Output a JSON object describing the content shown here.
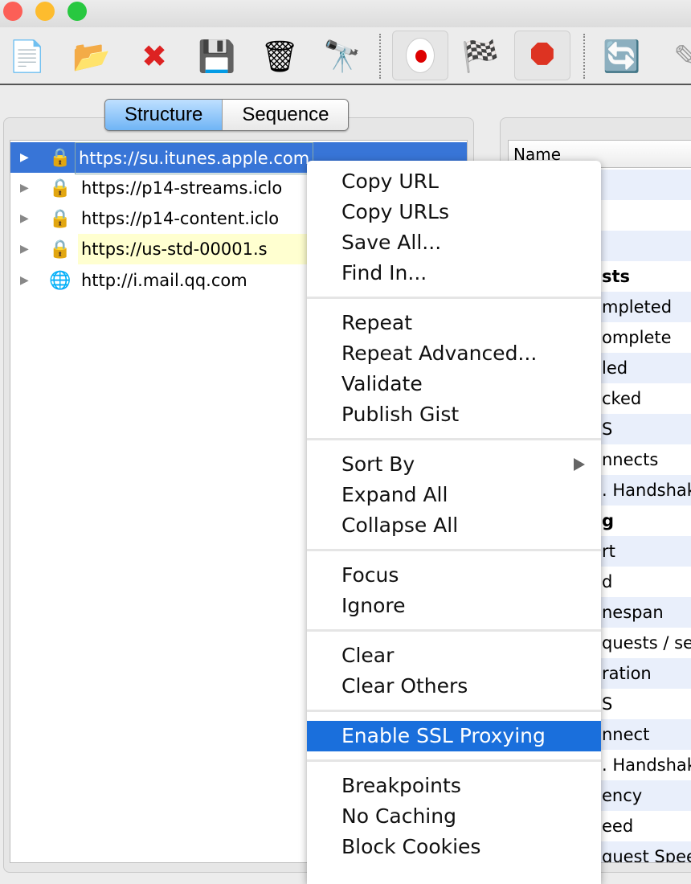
{
  "toolbar": {
    "icons": [
      "new-session-icon",
      "open-session-icon",
      "close-session-icon",
      "save-icon",
      "trash-icon",
      "binoculars-icon",
      "record-icon",
      "checkered-flag-icon",
      "stop-icon",
      "refresh-icon",
      "pencil-icon"
    ]
  },
  "view_tabs": {
    "structure": "Structure",
    "sequence": "Sequence",
    "active": "Structure"
  },
  "tree": {
    "rows": [
      {
        "label": "https://su.itunes.apple.com",
        "icon": "lock-icon",
        "selected": true
      },
      {
        "label": "https://p14-streams.iclo",
        "icon": "lock-icon"
      },
      {
        "label": "https://p14-content.iclo",
        "icon": "lock-icon"
      },
      {
        "label": "https://us-std-00001.s",
        "icon": "lock-icon",
        "highlighted": true
      },
      {
        "label": "http://i.mail.qq.com",
        "icon": "globe-icon"
      }
    ]
  },
  "overview": {
    "header": "Name",
    "rows": [
      "",
      "",
      "",
      "sts",
      "mpleted",
      "omplete",
      "led",
      "cked",
      "S",
      "nnects",
      ". Handshak",
      "g",
      "rt",
      "d",
      "nespan",
      "quests / se",
      "ration",
      "S",
      "nnect",
      ". Handshak",
      "ency",
      "eed",
      "quest Speed"
    ]
  },
  "context_menu": {
    "groups": [
      [
        "Copy URL",
        "Copy URLs",
        "Save All...",
        "Find In..."
      ],
      [
        "Repeat",
        "Repeat Advanced...",
        "Validate",
        "Publish Gist"
      ],
      [
        "Sort By",
        "Expand All",
        "Collapse All"
      ],
      [
        "Focus",
        "Ignore"
      ],
      [
        "Clear",
        "Clear Others"
      ],
      [
        "Enable SSL Proxying"
      ],
      [
        "Breakpoints",
        "No Caching",
        "Block Cookies"
      ]
    ],
    "highlighted": "Enable SSL Proxying",
    "submenu": "Sort By"
  },
  "colors": {
    "selection": "#3875d7",
    "menu_highlight": "#1a6fdc",
    "row_alt": "#e9effb"
  }
}
